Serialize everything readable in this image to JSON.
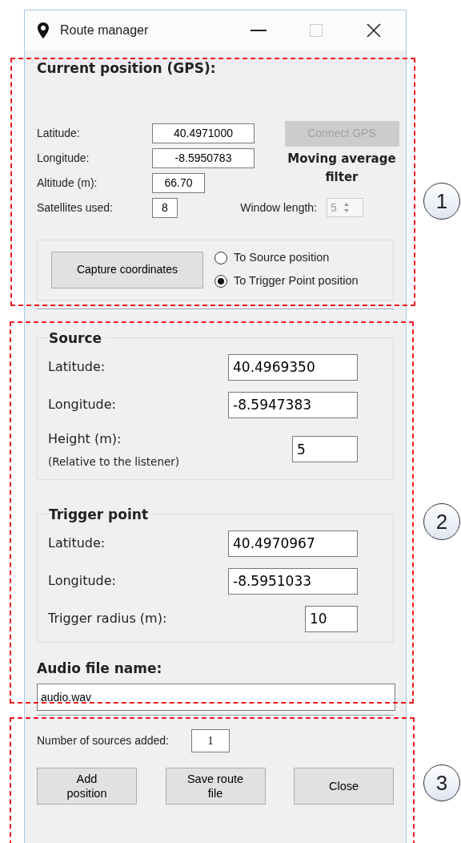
{
  "window": {
    "title": "Route manager"
  },
  "current_position": {
    "heading": "Current position (GPS):",
    "fields": [
      {
        "label": "Latitude:",
        "value": "40.4971000"
      },
      {
        "label": "Longitude:",
        "value": "-8.5950783"
      },
      {
        "label": "Altitude (m):",
        "value": "66.70"
      },
      {
        "label": "Satellites used:",
        "value": "8"
      }
    ],
    "connect_button": {
      "label": "Connect GPS",
      "disabled": true
    },
    "filter_heading": "Moving average filter",
    "window_length": {
      "label": "Window length:",
      "value": "5",
      "disabled": true
    },
    "capture_button": "Capture coordinates",
    "targets": [
      {
        "label": "To Source position",
        "selected": false
      },
      {
        "label": "To Trigger Point position",
        "selected": true
      }
    ]
  },
  "source": {
    "title": "Source",
    "fields": [
      {
        "label": "Latitude:",
        "value": "40.4969350"
      },
      {
        "label": "Longitude:",
        "value": "-8.5947383"
      },
      {
        "label": "Height (m):",
        "note": "(Relative to the listener)",
        "value": "5"
      }
    ]
  },
  "trigger_point": {
    "title": "Trigger point",
    "fields": [
      {
        "label": "Latitude:",
        "value": "40.4970967"
      },
      {
        "label": "Longitude:",
        "value": "-8.5951033"
      },
      {
        "label": "Trigger radius (m):",
        "value": "10"
      }
    ]
  },
  "audio_file": {
    "label": "Audio file name:",
    "value": "audio.wav"
  },
  "sources_added": {
    "label": "Number of sources added:",
    "value": "1"
  },
  "buttons": [
    "Add position",
    "Save route file",
    "Close"
  ],
  "annotations": [
    {
      "number": "1"
    },
    {
      "number": "2"
    },
    {
      "number": "3"
    }
  ]
}
